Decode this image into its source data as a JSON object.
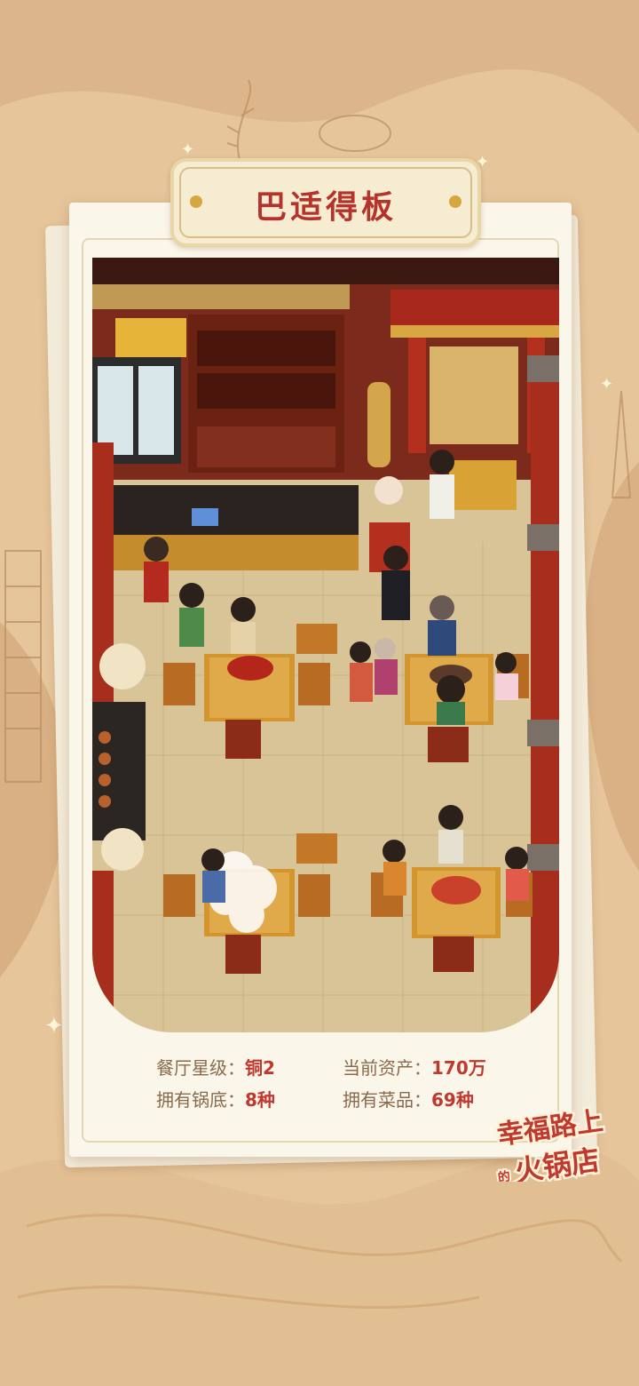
{
  "title": "巴适得板",
  "stats": {
    "rating_label": "餐厅星级：",
    "rating_value": "铜2",
    "assets_label": "当前资产：",
    "assets_value": "170万",
    "soup_label": "拥有锅底：",
    "soup_value": "8种",
    "dishes_label": "拥有菜品：",
    "dishes_value": "69种"
  },
  "logo": {
    "line1": "幸福路上",
    "line2_small": "的",
    "line2": "火锅店"
  },
  "colors": {
    "accent_red": "#c0382e",
    "wood_dark": "#6e2718",
    "floor": "#d9c69a",
    "gold": "#d7a640"
  }
}
